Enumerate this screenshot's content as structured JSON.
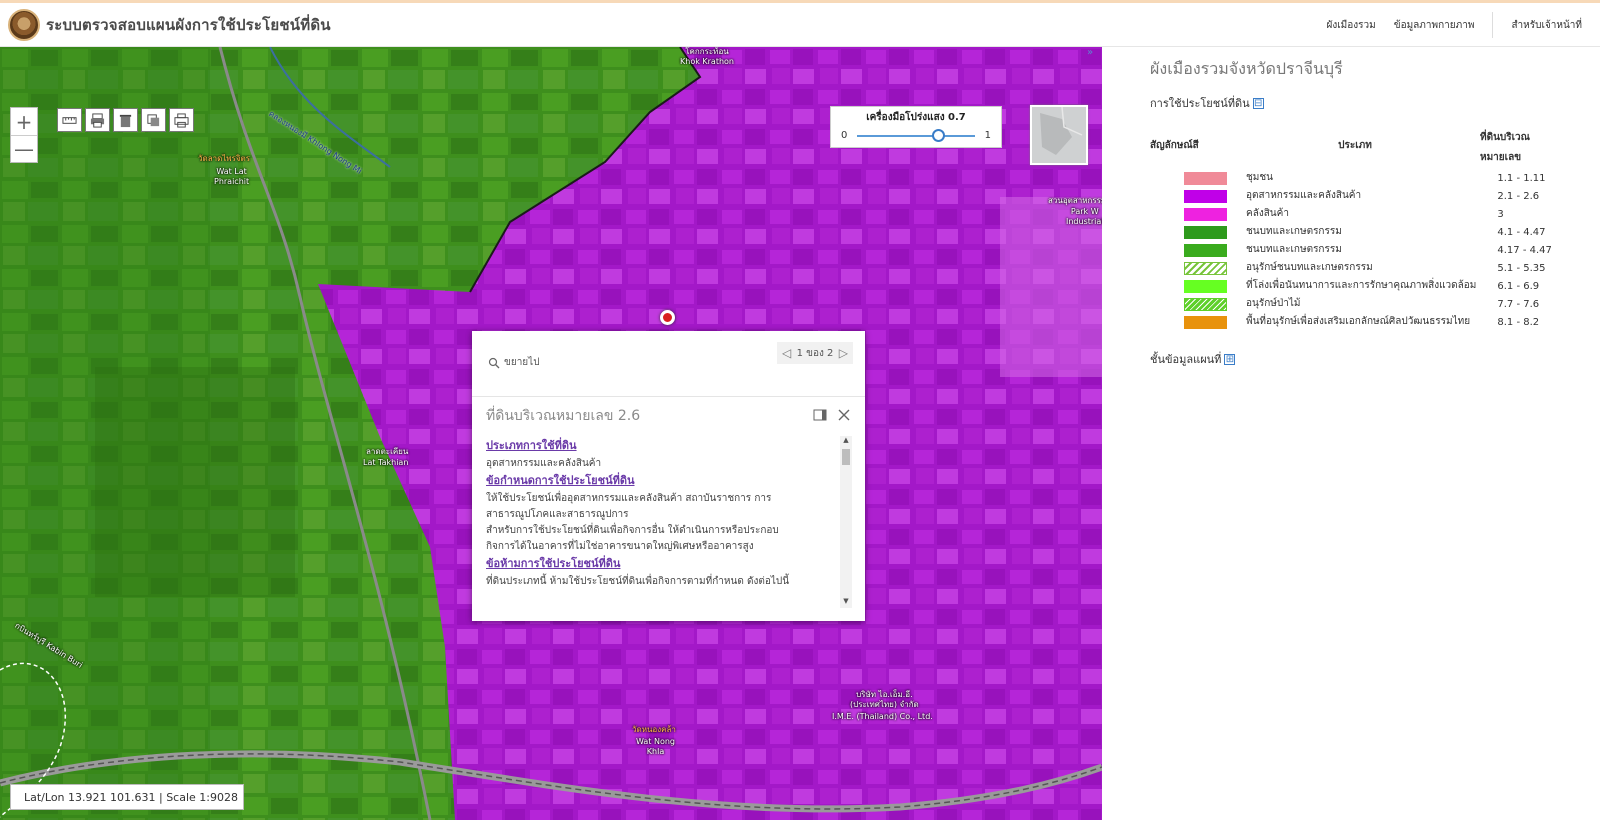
{
  "header": {
    "title": "ระบบตรวจสอบแผนผังการใช้ประโยชน์ที่ดิน",
    "nav": [
      "ผังเมืองรวม",
      "ข้อมูลภาพกายภาพ",
      "สำหรับเจ้าหน้าที่"
    ]
  },
  "map": {
    "zoom_in": "+",
    "zoom_out": "—",
    "tool_icons": [
      "ruler-icon",
      "printer-tool-icon",
      "trash-icon",
      "copy-icon",
      "print-icon"
    ],
    "opacity": {
      "title": "เครื่องมือโปร่งแสง 0.7",
      "min": "0",
      "max": "1",
      "value": 0.7
    },
    "labels": {
      "khok_krathon_th": "โคกกระท้อน",
      "khok_krathon_en": "Khok Krathon",
      "canal": "คลองหนองมี Khlong Nong Mi",
      "wat_lat_th": "วัดลาดไพรจิตร",
      "wat_lat_en": "Wat Lat\nPhraichit",
      "park_th": "สวนอุตสาหกรรม",
      "park_en": "Park W\nIndustrial",
      "lat_takhian_th": "ลาดตะเคียน",
      "lat_takhian_en": "Lat Takhian",
      "kabin_buri": "กบินทร์บุรี Kabin Buri",
      "ime_th": "บริษัท ไอ.เอ็ม.อี.\n(ประเทศไทย) จำกัด",
      "ime_en": "I.M.E. (Thailand) Co., Ltd.",
      "wat_nong_khla_th": "วัดหนองคล้า",
      "wat_nong_khla_en": "Wat Nong\nKhla"
    },
    "coords": "Lat/Lon 13.921 101.631 | Scale 1:9028"
  },
  "popup": {
    "zoom_to": "ขยายไป",
    "pager": "1 ของ 2",
    "title": "ที่ดินบริเวณหมายเลข 2.6",
    "sections": [
      {
        "heading": "ประเภทการใช้ที่ดิน",
        "lines": [
          "อุตสาหกรรมและคลังสินค้า"
        ]
      },
      {
        "heading": "ข้อกำหนดการใช้ประโยชน์ที่ดิน",
        "lines": [
          "ให้ใช้ประโยชน์เพื่ออุตสาหกรรมและคลังสินค้า สถาบันราชการ การ",
          "สาธารณูปโภคและสาธารณูปการ",
          "สำหรับการใช้ประโยชน์ที่ดินเพื่อกิจการอื่น ให้ดำเนินการหรือประกอบ",
          "กิจการได้ในอาคารที่ไม่ใช่อาคารขนาดใหญ่พิเศษหรืออาคารสูง"
        ]
      },
      {
        "heading": "ข้อห้ามการใช้ประโยชน์ที่ดิน",
        "lines": [
          "ที่ดินประเภทนี้ ห้ามใช้ประโยชน์ที่ดินเพื่อกิจการตามที่กำหนด ดังต่อไปนี้"
        ]
      }
    ]
  },
  "sidebar": {
    "collapse": "»",
    "title": "ผังเมืองรวมจังหวัดปราจีนบุรี",
    "land_use_toggle": "การใช้ประโยชน์ที่ดิน",
    "land_use_toggle_icon": "⊟",
    "legend_headers": {
      "symbol": "สัญลักษณ์สี",
      "type": "ประเภท",
      "number": "ที่ดินบริเวณ\nหมายเลข"
    },
    "legend": [
      {
        "name": "ชุมชน",
        "number": "1.1 - 1.11",
        "color": "#f08a98",
        "style": "solid"
      },
      {
        "name": "อุตสาหกรรมและคลังสินค้า",
        "number": "2.1 - 2.6",
        "color": "#c000e8",
        "style": "solid"
      },
      {
        "name": "คลังสินค้า",
        "number": "3",
        "color": "#ee22e0",
        "style": "solid"
      },
      {
        "name": "ชนบทและเกษตรกรรม",
        "number": "4.1 - 4.47",
        "color": "#2e9a1c",
        "style": "solid"
      },
      {
        "name": "ชนบทและเกษตรกรรม",
        "number": "4.17 - 4.47",
        "color": "#3aab1e",
        "style": "solid"
      },
      {
        "name": "อนุรักษ์ชนบทและเกษตรกรรม",
        "number": "5.1 - 5.35",
        "color": "#77c43b",
        "style": "hatch-white"
      },
      {
        "name": "ที่โล่งเพื่อนันทนาการและการรักษาคุณภาพสิ่งแวดล้อม",
        "number": "6.1 - 6.9",
        "color": "#66ff22",
        "style": "solid"
      },
      {
        "name": "อนุรักษ์ป่าไม้",
        "number": "7.7 - 7.6",
        "color": "#5fd02a",
        "style": "hatch-green"
      },
      {
        "name": "พื้นที่อนุรักษ์เพื่อส่งเสริมเอกลักษณ์ศิลปวัฒนธรรมไทย",
        "number": "8.1 - 8.2",
        "color": "#e8920c",
        "style": "solid"
      }
    ],
    "layers_toggle": "ชั้นข้อมูลแผนที่",
    "layers_toggle_icon": "⊞"
  }
}
